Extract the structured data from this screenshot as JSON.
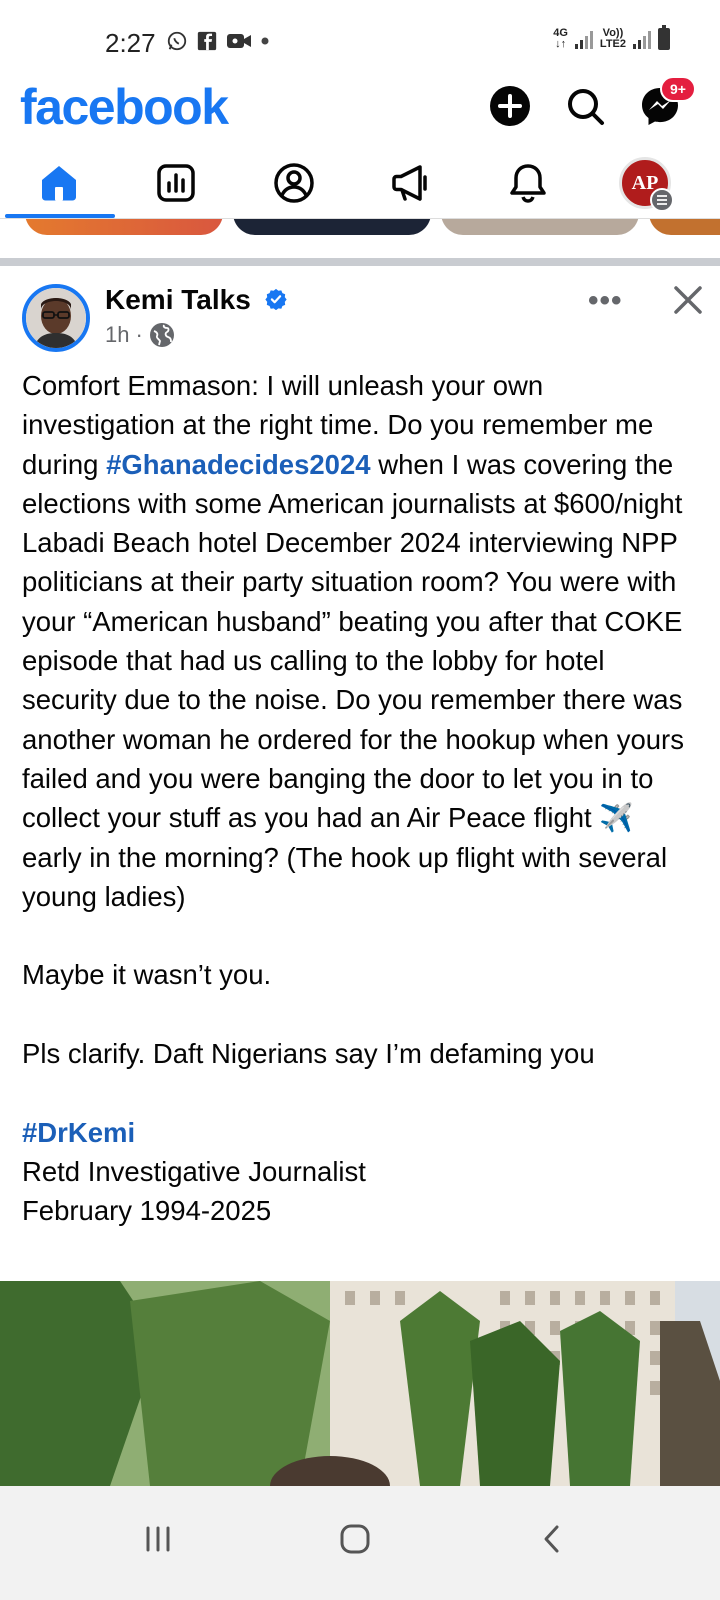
{
  "status_bar": {
    "time": "2:27",
    "network_top": "4G",
    "network_bottom_a": "Vo))",
    "network_bottom_b": "LTE2"
  },
  "header": {
    "logo": "facebook",
    "messenger_badge": "9+",
    "accent_color": "#1877f2",
    "badge_color": "#e41e3f"
  },
  "tabs": [
    {
      "name": "home",
      "icon": "home-icon",
      "active": true
    },
    {
      "name": "feeds",
      "icon": "chart-icon",
      "active": false
    },
    {
      "name": "profile",
      "icon": "profile-icon",
      "active": false
    },
    {
      "name": "marketplace",
      "icon": "megaphone-icon",
      "active": false
    },
    {
      "name": "notifications",
      "icon": "bell-icon",
      "active": false
    },
    {
      "name": "menu",
      "icon": "avatar-icon",
      "active": false
    }
  ],
  "menu_avatar_text": "AP",
  "post": {
    "author": "Kemi Talks",
    "time": "1h",
    "separator": "·",
    "line1_a": "Comfort Emmason: I will unleash your own investigation at the right time. Do you remember me during ",
    "hashtag1": "#Ghanadecides2024",
    "line1_b": " when I was covering the elections with some American journalists at $600/night Labadi Beach hotel December 2024 interviewing NPP politicians at their party situation room? You were with your “American husband” beating you after that COKE episode that had us calling to the lobby for hotel security due to the noise. Do you remember there was another woman he ordered for the hookup when yours failed and you were banging the door to let you in to collect your stuff as you had an Air Peace flight ✈️ early in the morning? (The hook up flight with several young ladies)",
    "line2": "Maybe it wasn’t you.",
    "line3": "Pls clarify. Daft Nigerians say I’m defaming you",
    "hashtag2": "#DrKemi",
    "sig1": "Retd Investigative Journalist",
    "sig2": "February 1994-2025"
  }
}
